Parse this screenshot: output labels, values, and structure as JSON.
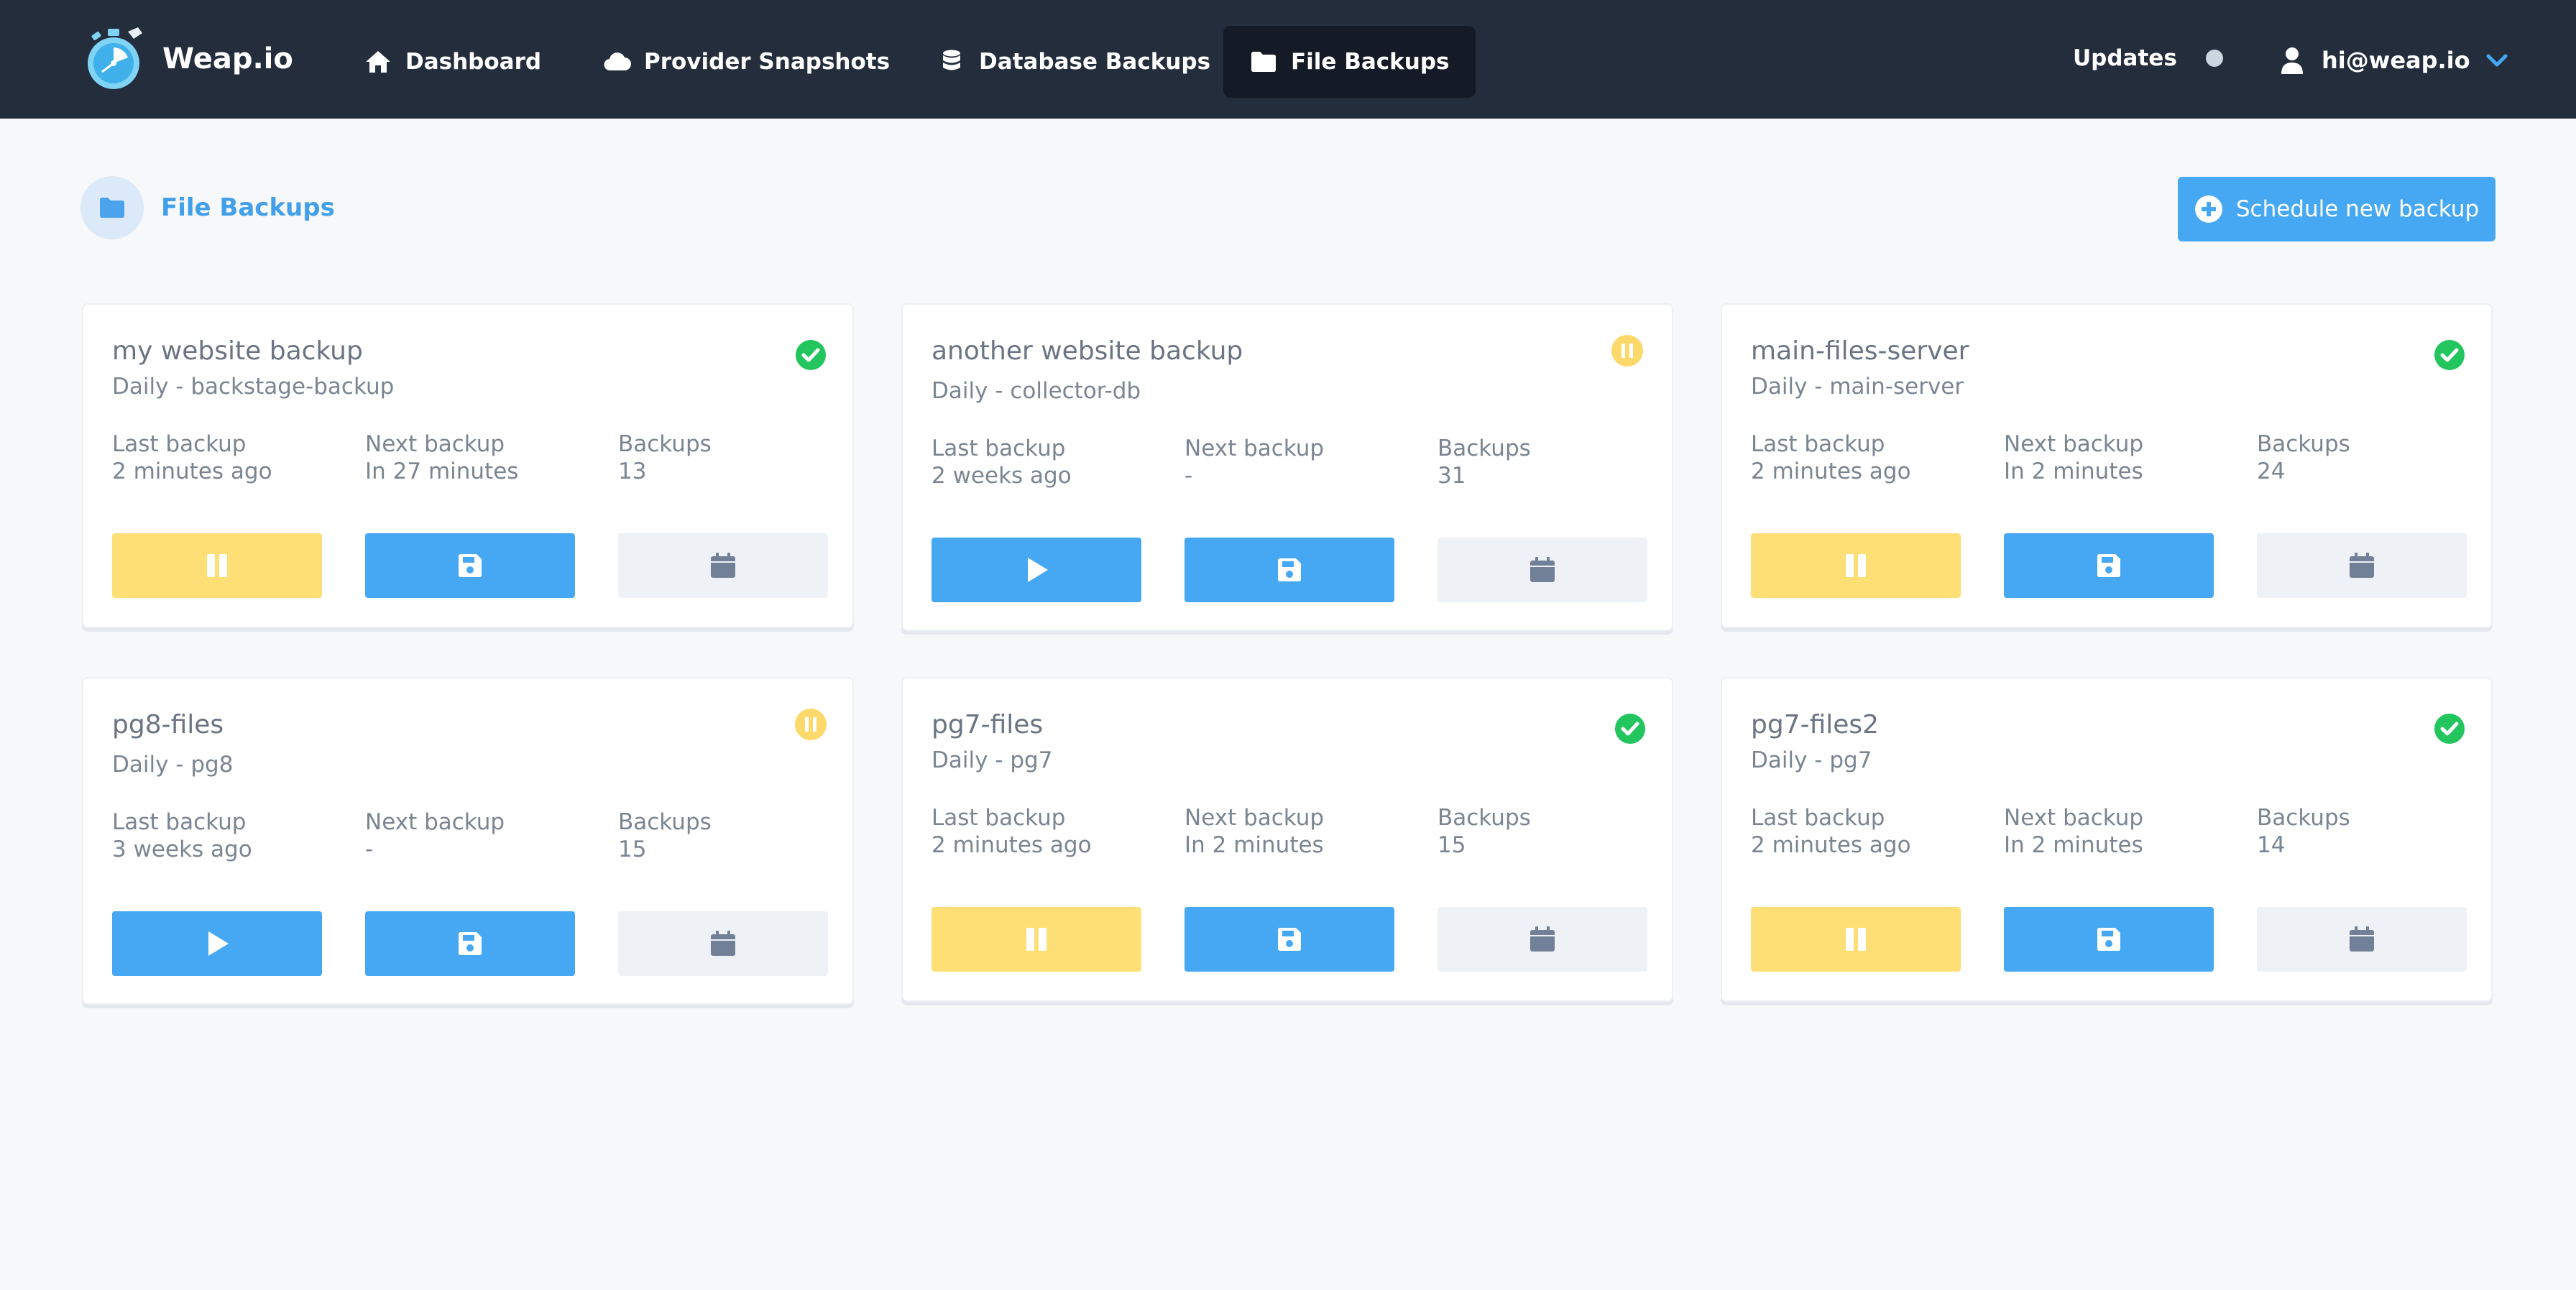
{
  "brand": {
    "name": "Weap.io"
  },
  "nav": {
    "dashboard": "Dashboard",
    "provider_snapshots": "Provider Snapshots",
    "database_backups": "Database Backups",
    "file_backups": "File Backups"
  },
  "updates_label": "Updates",
  "user_email": "hi@weap.io",
  "page": {
    "title": "File Backups",
    "schedule_button": "Schedule new backup"
  },
  "labels": {
    "last_backup": "Last backup",
    "next_backup": "Next backup",
    "backups": "Backups"
  },
  "colors": {
    "nav_bg": "#232d3c",
    "accent_blue": "#46a8f2",
    "pause_yellow": "#fddf75",
    "status_green": "#22c55e",
    "status_paused": "#fdd86b"
  },
  "backups": [
    {
      "name": "my website backup",
      "schedule": "Daily - backstage-backup",
      "status": "active",
      "last": "2 minutes ago",
      "next": "In 27 minutes",
      "count": "13",
      "primary_action": "pause"
    },
    {
      "name": "another website backup",
      "schedule": "Daily - collector-db",
      "status": "paused",
      "last": "2 weeks ago",
      "next": "-",
      "count": "31",
      "primary_action": "play"
    },
    {
      "name": "main-files-server",
      "schedule": "Daily - main-server",
      "status": "active",
      "last": "2 minutes ago",
      "next": "In 2 minutes",
      "count": "24",
      "primary_action": "pause"
    },
    {
      "name": "pg8-files",
      "schedule": "Daily - pg8",
      "status": "paused",
      "last": "3 weeks ago",
      "next": "-",
      "count": "15",
      "primary_action": "play"
    },
    {
      "name": "pg7-files",
      "schedule": "Daily - pg7",
      "status": "active",
      "last": "2 minutes ago",
      "next": "In 2 minutes",
      "count": "15",
      "primary_action": "pause"
    },
    {
      "name": "pg7-files2",
      "schedule": "Daily - pg7",
      "status": "active",
      "last": "2 minutes ago",
      "next": "In 2 minutes",
      "count": "14",
      "primary_action": "pause"
    }
  ]
}
